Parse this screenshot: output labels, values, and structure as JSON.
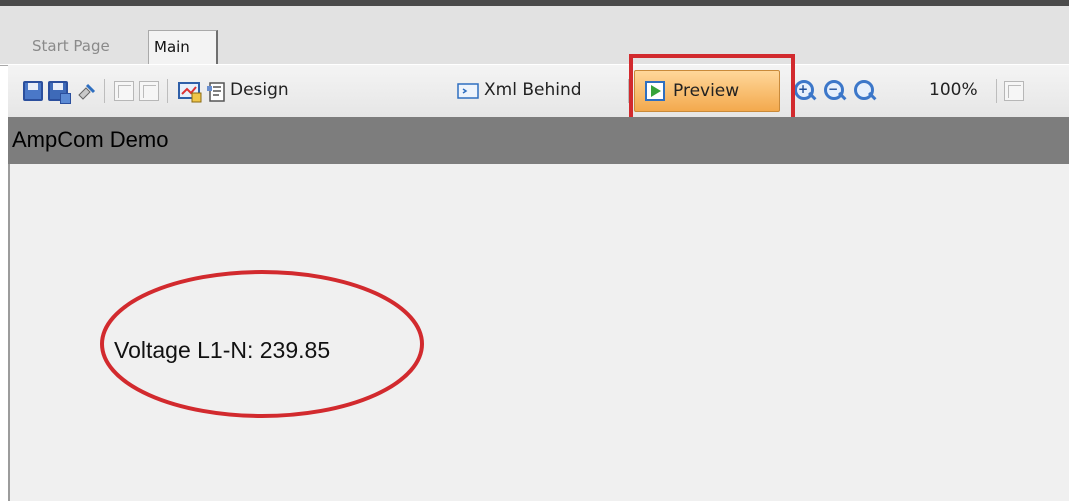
{
  "tabs": [
    {
      "label": "Start Page",
      "active": false
    },
    {
      "label": "Main",
      "active": true
    }
  ],
  "toolbar": {
    "icons_left": [
      "save-icon",
      "save-all-icon",
      "tool-icon",
      "disabled-toggle-icon",
      "disabled-copy-icon",
      "properties-icon",
      "document-icon"
    ],
    "design_label": "Design",
    "xml_label": "Xml Behind",
    "preview_label": "Preview",
    "zoom_label": "100%"
  },
  "app": {
    "title": "AmpCom Demo"
  },
  "canvas": {
    "voltage_text": "Voltage L1-N: 239.85"
  },
  "colors": {
    "highlight": "#d22a2e",
    "preview_bg": "#f3a94d",
    "titlebar": "#7d7d7d",
    "canvas_bg": "#f0f0f0"
  }
}
